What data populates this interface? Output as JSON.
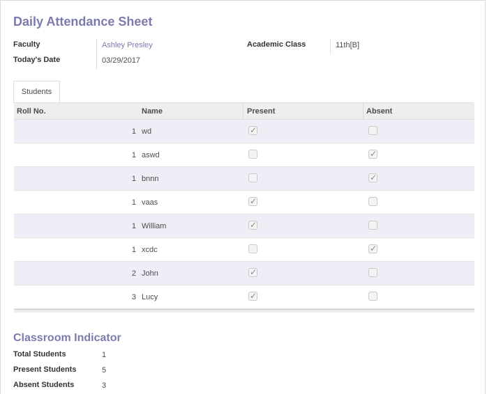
{
  "form": {
    "title": "Daily Attendance Sheet",
    "faculty_label": "Faculty",
    "faculty_value": "Ashley Presley",
    "date_label": "Today's Date",
    "date_value": "03/29/2017",
    "class_label": "Academic Class",
    "class_value": "11th[B]"
  },
  "tabs": [
    {
      "label": "Students"
    }
  ],
  "table": {
    "headers": {
      "roll": "Roll No.",
      "name": "Name",
      "present": "Present",
      "absent": "Absent"
    },
    "rows": [
      {
        "roll": "1",
        "name": "wd",
        "present": true,
        "absent": false
      },
      {
        "roll": "1",
        "name": "aswd",
        "present": false,
        "absent": true
      },
      {
        "roll": "1",
        "name": "bnnn",
        "present": false,
        "absent": true
      },
      {
        "roll": "1",
        "name": "vaas",
        "present": true,
        "absent": false
      },
      {
        "roll": "1",
        "name": "William",
        "present": true,
        "absent": false
      },
      {
        "roll": "1",
        "name": "xcdc",
        "present": false,
        "absent": true
      },
      {
        "roll": "2",
        "name": "John",
        "present": true,
        "absent": false
      },
      {
        "roll": "3",
        "name": "Lucy",
        "present": true,
        "absent": false
      }
    ]
  },
  "indicator": {
    "title": "Classroom Indicator",
    "total_label": "Total Students",
    "total_value": "1",
    "present_label": "Present Students",
    "present_value": "5",
    "absent_label": "Absent Students",
    "absent_value": "3"
  },
  "icons": {
    "checkbox_checked": "checkmark-icon"
  },
  "colors": {
    "accent": "#7c7bad",
    "row_alt": "#eeeef7",
    "header_bg": "#eeeeee"
  }
}
